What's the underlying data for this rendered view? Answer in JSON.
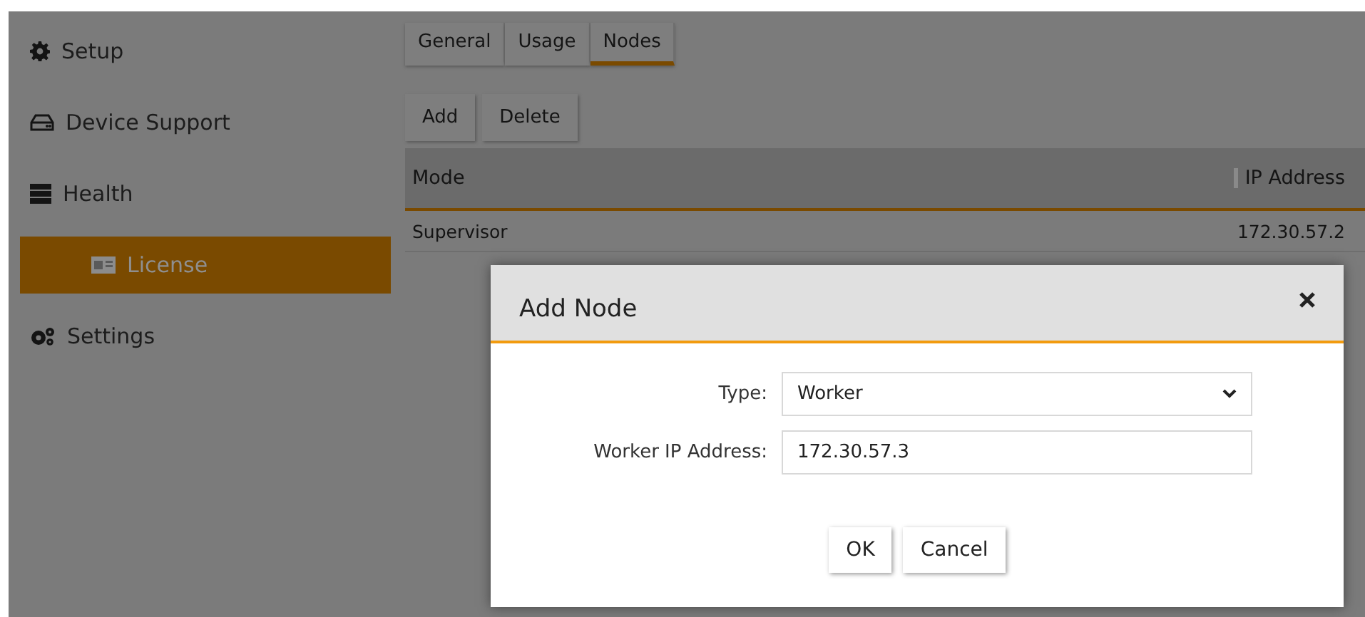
{
  "sidebar": {
    "items": [
      {
        "label": "Setup",
        "selected": false
      },
      {
        "label": "Device Support",
        "selected": false
      },
      {
        "label": "Health",
        "selected": false,
        "children": [
          {
            "label": "License",
            "selected": true
          }
        ]
      },
      {
        "label": "Settings",
        "selected": false
      }
    ]
  },
  "tabs": [
    {
      "label": "General",
      "selected": false
    },
    {
      "label": "Usage",
      "selected": false
    },
    {
      "label": "Nodes",
      "selected": true
    }
  ],
  "toolbar": [
    "Add",
    "Delete"
  ],
  "table": {
    "columns": [
      "Mode",
      "IP Address"
    ],
    "rows": [
      [
        "Supervisor",
        "172.30.57.2"
      ]
    ]
  },
  "dialog": {
    "title": "Add Node",
    "fields": [
      {
        "label": "Type:",
        "kind": "select",
        "value": "Worker"
      },
      {
        "label": "Worker IP Address:",
        "kind": "text",
        "value": "172.30.57.3"
      }
    ],
    "buttons": [
      "OK",
      "Cancel"
    ]
  }
}
